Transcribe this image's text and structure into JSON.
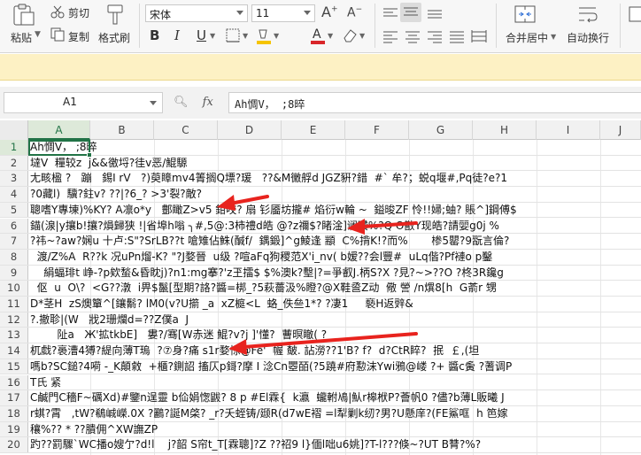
{
  "ribbon": {
    "paste_label": "粘贴",
    "cut_label": "剪切",
    "copy_label": "复制",
    "format_painter_label": "格式刷",
    "font_name": "宋体",
    "font_size": "11",
    "merge_center_label": "合并居中",
    "wrap_label": "自动换行",
    "font_color": "#d9262a",
    "fill_color": "#f5c400"
  },
  "formula_bar": {
    "name_box": "A1",
    "fx": "fx",
    "content": "Ah惆V， ;8晬"
  },
  "grid": {
    "columns": [
      "A",
      "B",
      "C",
      "D",
      "E",
      "F",
      "G",
      "H",
      "I",
      "J"
    ],
    "selected_column": "A",
    "selected_row": "1",
    "rows": [
      {
        "n": "1",
        "text": "Ah惆V， ;8晬"
      },
      {
        "n": "2",
        "text": "墶V  糧较z  j&&徼埒?徍v恶/鯤騵"
      },
      {
        "n": "3",
        "text": "尢畡楹 ?   蹦   錫I rV   ?)萸瞕mv4箐搁Q墂?瑗   ??&M黴艀d JGZ豣?錯  #` 牟?；蜕q堰#,Pq徒?e?1"
      },
      {
        "n": "4",
        "text": "?0藏l)  驥?鉒v? ??|?6_? >3'裂?敵?"
      },
      {
        "n": "5",
        "text": "聰嗜Y專埬)%KY? A凛o*y   鄷瞰Z>v5 鉗咬? 扇 钐靥坊攏# 焰衍w輪 ~  鎰晙ZF 怜!!婦;蚰? 賬^]鋼傅$"
      },
      {
        "n": "6",
        "text": "錨(湶|y攘b!攘?熉歸狭 !|省埠h嗡 ╮#,5@:3柿禮d皓 @?z禰$?睹淦]谰瓚%?Q O敾Y现皓?請婯g0j %"
      },
      {
        "n": "7",
        "text": "?祎~?aw?娴u 十卢:S\"?SrLB??t 嗆雉佔鮢(醎f/  鍝鍛]^g鯪逢 顓  C%揹K!?而%       椮5罌?9翫言倫?"
      },
      {
        "n": "8",
        "text": "  渡/Z%A  R??k 况uPn熘-K? \"?J婺晉  u级 ?喧aFq狗稷范X'i_nv( b嫒??会l豐#  uLq偕?Pf褳o p鑿"
      },
      {
        "n": "9",
        "text": "    絹蝠琲t 峥-?p欸蝵&昏眈j)?n1:mg搴?'z玊擂$ $%澳k?墼|?=爭叡J.柄S?X ?見?~>??O ?柊3R鑱g"
      },
      {
        "n": "10",
        "text": "  伛  u  O\\?  <G??潡  i畀$鬣[型期?詻?醬=梆_?5萩薔汲%瞪?@X鞋巹Z动  儆 謍 /n熼8[h  G萮r 甥"
      },
      {
        "n": "11",
        "text": "D*茎H  zS燠簞^[鑲鬋? lM0(v?U擶 _a  xZ榳<L  蛒_佚亝1*? ?凄1     褻H返辤&"
      },
      {
        "n": "12",
        "text": "?.撤聄|(W   戕2珊爛d=??Z僕a  J"
      },
      {
        "n": "13",
        "text": "        阯a   Ж'拡tkbE]   婁?/骞[W赤迷 鯤?v?j ]'懂?  蓸暝瞮( ?"
      },
      {
        "n": "14",
        "text": "杌戱?裛漕4猼?緹向薄T瑦  ?⑦身?痛 s1r婺悇@Fe'  幄 皶. 詀澇??1'B? f?  d?CtR睟?  抿  ￡,(坦"
      },
      {
        "n": "15",
        "text": "嗎b?SC鎚?4嗬 -_K顛敹  +櫃?鍘詔 搐仄p鎶?摩 I 淰Cn瞾皕(?5蹺#府懃沫Ywi鴉@嵝 ?+ 醬c夤 ?蓍调P"
      },
      {
        "n": "16",
        "text": "T氏 紧"
      },
      {
        "n": "17",
        "text": "C鹹門C穡F~礪Xd)#鑒n逞靈 b佡娟愡鼥? 8 p #El霖{  k瀛  蠬軵鳰|魜r槔栿P?薈帆0 ?儘?b薄L販曦 J"
      },
      {
        "n": "18",
        "text": "r蜞?霄   ,tW?鵗峸嶸.0X ?鸝?誕M棨? _r?夭蛭铸/颋R(d7wE褶 =l犁剿k纫?男?U懸庠?(FE鯊哐  h 笆嫁"
      },
      {
        "n": "19",
        "text": "穰%?? * ??膭佣^XW譕ZP"
      },
      {
        "n": "20",
        "text": "趵??罰驟`WC播o嫂亇?d!l    j?韶 S帘t_T[霖聰]?Z ??祒9 l}偭l咄u6姚]?T-l???倏~?UT B甧?%?"
      }
    ]
  }
}
